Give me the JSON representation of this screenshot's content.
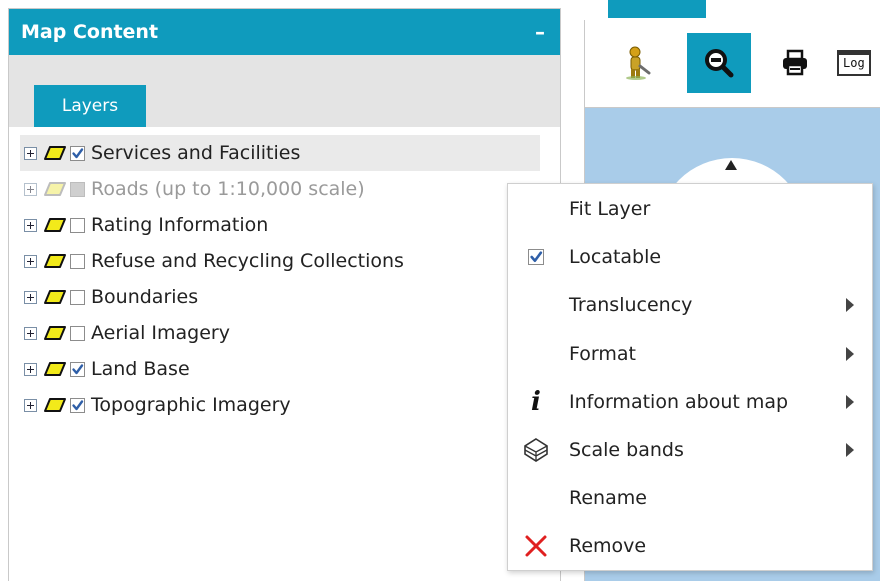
{
  "panel": {
    "title": "Map Content",
    "minimize_glyph": "–",
    "tab_label": "Layers"
  },
  "layers": [
    {
      "label": "Services and Facilities",
      "checked": true,
      "enabled": true,
      "highlighted": true
    },
    {
      "label": "Roads (up to 1:10,000 scale)",
      "checked": false,
      "enabled": false,
      "highlighted": false
    },
    {
      "label": "Rating Information",
      "checked": false,
      "enabled": true,
      "highlighted": false
    },
    {
      "label": "Refuse and Recycling Collections",
      "checked": false,
      "enabled": true,
      "highlighted": false
    },
    {
      "label": "Boundaries",
      "checked": false,
      "enabled": true,
      "highlighted": false
    },
    {
      "label": "Aerial Imagery",
      "checked": false,
      "enabled": true,
      "highlighted": false
    },
    {
      "label": "Land Base",
      "checked": true,
      "enabled": true,
      "highlighted": false
    },
    {
      "label": "Topographic Imagery",
      "checked": true,
      "enabled": true,
      "highlighted": false
    }
  ],
  "toolbar": {
    "tools": [
      {
        "icon": "streetview-person-icon",
        "active": false
      },
      {
        "icon": "zoom-icon",
        "active": true
      },
      {
        "icon": "print-icon",
        "active": false
      },
      {
        "icon": "log-icon",
        "active": false,
        "label": "Log"
      }
    ]
  },
  "context_menu": {
    "items": [
      {
        "label": "Fit Layer",
        "icon": null,
        "submenu": false
      },
      {
        "label": "Locatable",
        "icon": "checkbox-checked-icon",
        "submenu": false
      },
      {
        "label": "Translucency",
        "icon": null,
        "submenu": true
      },
      {
        "label": "Format",
        "icon": null,
        "submenu": true
      },
      {
        "label": "Information about map",
        "icon": "info-icon",
        "submenu": true
      },
      {
        "label": "Scale bands",
        "icon": "scale-bands-icon",
        "submenu": true
      },
      {
        "label": "Rename",
        "icon": null,
        "submenu": false
      },
      {
        "label": "Remove",
        "icon": "remove-x-icon",
        "submenu": false
      }
    ]
  },
  "colors": {
    "accent": "#0f9bbd",
    "map_water": "#a9cce9",
    "layer_symbol_fill": "#f2ea1a",
    "checkbox_check": "#2f5fa8",
    "remove_red": "#e02020"
  }
}
